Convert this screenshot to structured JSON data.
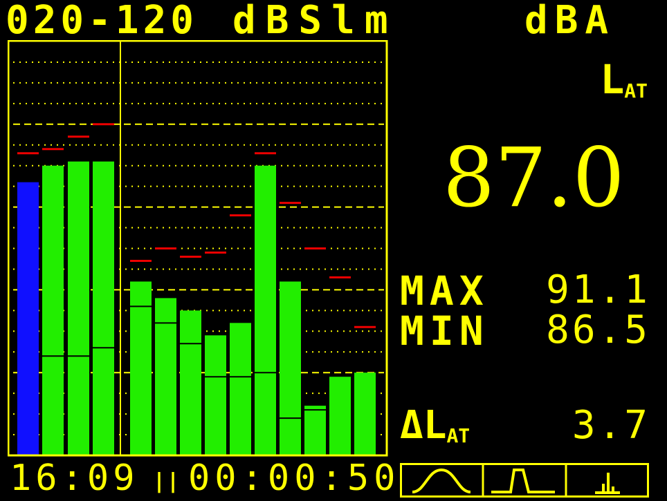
{
  "header": {
    "range": "020-120",
    "unit": "dBSlm",
    "weighting": "dBA"
  },
  "readout": {
    "label": "L",
    "label_sub": "AT",
    "value": "87.0",
    "max_label": "MAX",
    "max_value": "91.1",
    "min_label": "MIN",
    "min_value": "86.5",
    "delta_label": "ΔL",
    "delta_sub": "AT",
    "delta_value": "3.7"
  },
  "footer": {
    "clock": "16:09",
    "status_icon": "pause-icon",
    "elapsed": "00:00:50"
  },
  "mode_buttons": [
    {
      "name": "sine-wave-mode-icon"
    },
    {
      "name": "pulse-mode-icon"
    },
    {
      "name": "spectrum-mode-icon"
    }
  ],
  "colors": {
    "text": "#ffff00",
    "bar_main": "#22ee00",
    "bar_total": "#1010ff",
    "peak_marker": "#ee0000",
    "background": "#000000"
  },
  "chart_data": {
    "type": "bar",
    "ylim": [
      20,
      120
    ],
    "grid": true,
    "series": [
      {
        "values": [
          86,
          90,
          91,
          91,
          62,
          58,
          55,
          49,
          52,
          90,
          62,
          32,
          39,
          40
        ],
        "colors": [
          "#1010ff",
          "#22ee00",
          "#22ee00",
          "#22ee00",
          "#22ee00",
          "#22ee00",
          "#22ee00",
          "#22ee00",
          "#22ee00",
          "#22ee00",
          "#22ee00",
          "#22ee00",
          "#22ee00",
          "#22ee00"
        ]
      }
    ],
    "min_markers": [
      null,
      44,
      44,
      46,
      56,
      52,
      47,
      39,
      39,
      40,
      29,
      31,
      null,
      41
    ],
    "peak_markers": [
      93,
      94,
      97,
      100,
      67,
      70,
      68,
      69,
      78,
      93,
      81,
      70,
      63,
      51
    ]
  }
}
